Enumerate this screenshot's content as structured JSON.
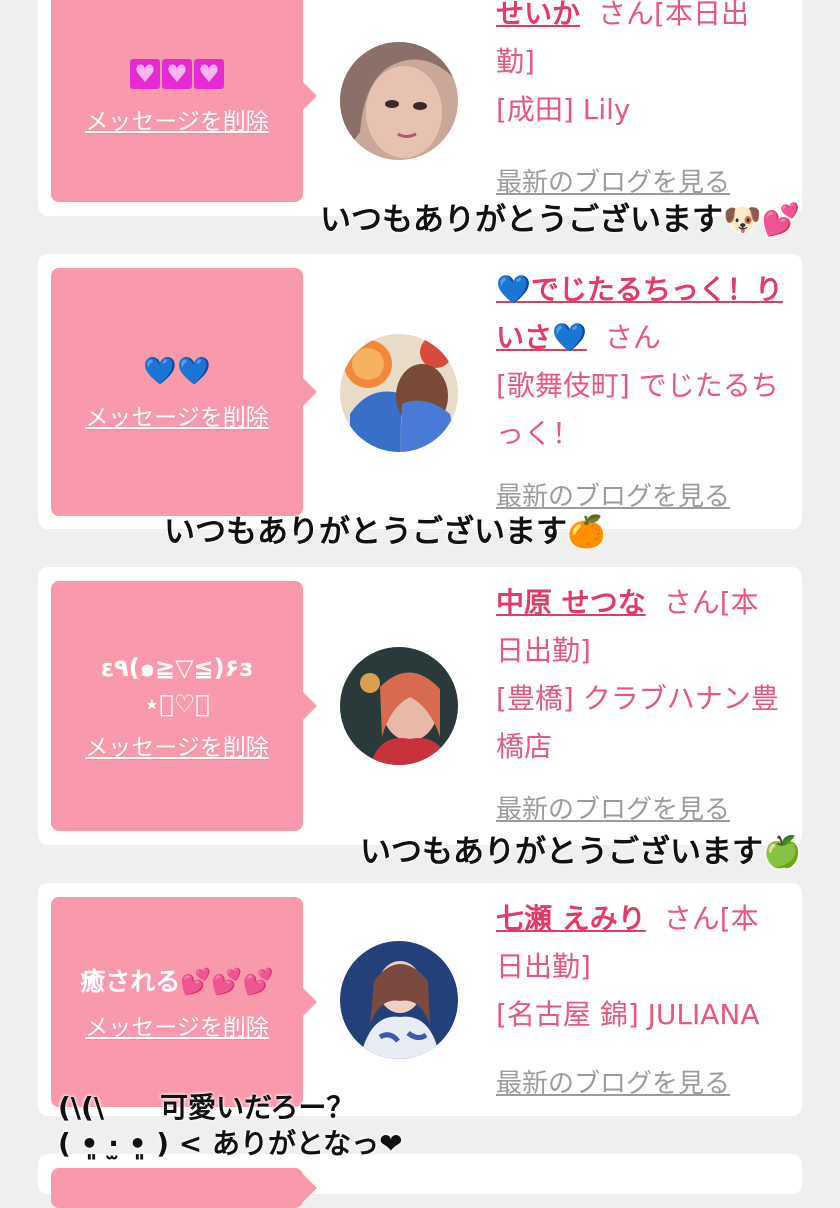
{
  "cards": [
    {
      "message": "💗💗💗",
      "delete_label": "メッセージを削除",
      "name": "せいか",
      "honorific": "さん[本日出勤]",
      "shop": "[成田] Lily",
      "blog_link": "最新のブログを見る"
    },
    {
      "message": "💙💙",
      "delete_label": "メッセージを削除",
      "name": "💙でじたるちっく！りいさ💙",
      "honorific": "さん",
      "shop": "[歌舞伎町] でじたるちっく！",
      "blog_link": "最新のブログを見る"
    },
    {
      "message": "ε٩(๑≧▽≦)۶з",
      "message_line2": "⋆͛♡͙",
      "delete_label": "メッセージを削除",
      "name": "中原 せつな",
      "honorific": "さん[本日出勤]",
      "shop": "[豊橋] クラブハナン豊橋店",
      "blog_link": "最新のブログを見る"
    },
    {
      "message": "癒される💕💕💕",
      "delete_label": "メッセージを削除",
      "name": "七瀬 えみり",
      "honorific": "さん[本日出勤]",
      "shop": "[名古屋 錦] JULIANA",
      "blog_link": "最新のブログを見る"
    }
  ],
  "overlays": [
    {
      "text": "いつもありがとうございます🐶💕"
    },
    {
      "text": "いつもありがとうございます🍊"
    },
    {
      "text": "いつもありがとうございます🍏"
    },
    {
      "line1": "(\\(\\　　可愛いだろー？",
      "line2": "( •͈ ·̫ •͈ ) < ありがとなっ❤"
    }
  ],
  "colors": {
    "accent": "#e23b68",
    "bubble": "#f99aac",
    "background": "#efefef",
    "link_gray": "#9c9c9c"
  }
}
